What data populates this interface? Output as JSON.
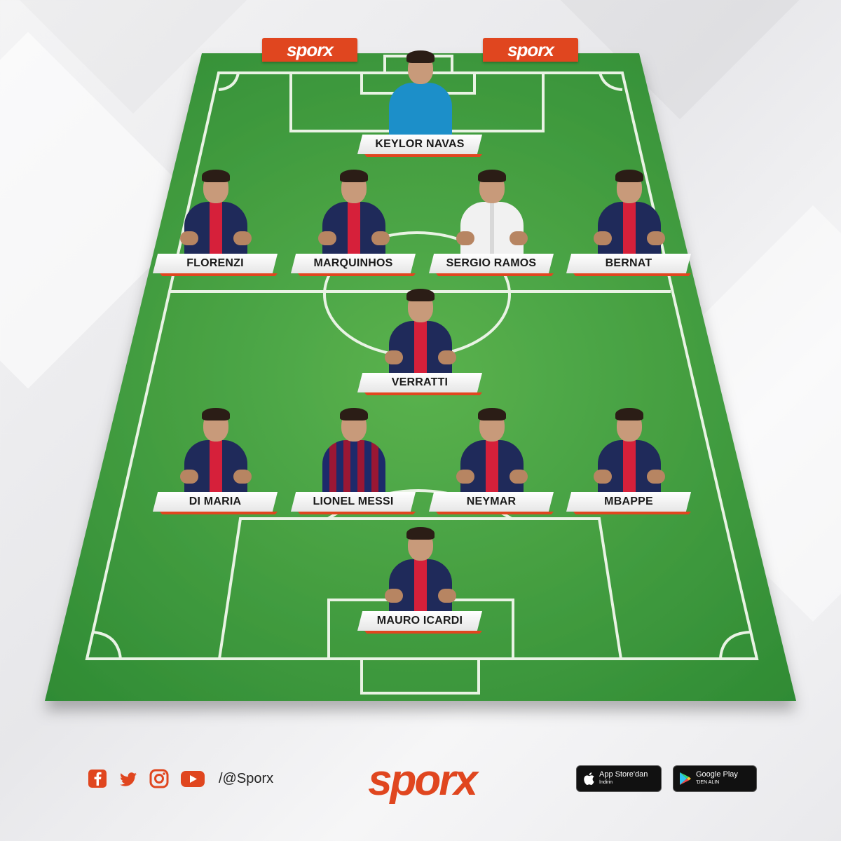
{
  "logo_tabs": [
    "sporx",
    "sporx"
  ],
  "players": [
    {
      "name": "KEYLOR NAVAS",
      "kit": "gk"
    },
    {
      "name": "FLORENZI",
      "kit": "psg"
    },
    {
      "name": "MARQUINHOS",
      "kit": "psg"
    },
    {
      "name": "SERGIO RAMOS",
      "kit": "real"
    },
    {
      "name": "BERNAT",
      "kit": "psg"
    },
    {
      "name": "VERRATTI",
      "kit": "psg"
    },
    {
      "name": "DI MARIA",
      "kit": "psg"
    },
    {
      "name": "LIONEL MESSI",
      "kit": "barca"
    },
    {
      "name": "NEYMAR",
      "kit": "psg"
    },
    {
      "name": "MBAPPE",
      "kit": "psg"
    },
    {
      "name": "MAURO ICARDI",
      "kit": "psg"
    }
  ],
  "footer": {
    "social_icons": [
      "facebook-icon",
      "twitter-icon",
      "instagram-icon",
      "youtube-icon"
    ],
    "handle": "/@Sporx",
    "brand": "sporx",
    "app_store": {
      "line1": "App Store'dan",
      "line2": "İndirin"
    },
    "google_play": {
      "line1": "Google Play",
      "line2": "'DEN ALIN"
    }
  },
  "colors": {
    "accent": "#e0461f",
    "pitch": "#3f9a3c",
    "psg_navy": "#1f2a5a",
    "psg_red": "#d6203a"
  }
}
